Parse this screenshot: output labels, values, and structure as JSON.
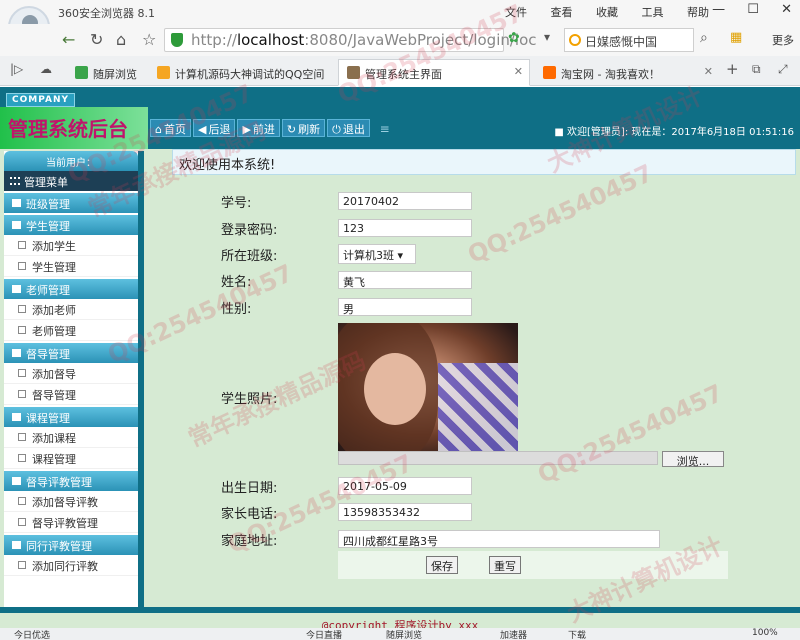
{
  "browser": {
    "title": "360安全浏览器 8.1",
    "menu": [
      "文件",
      "查看",
      "收藏",
      "工具",
      "帮助"
    ],
    "url_prefix": "http://",
    "url_host": "localhost",
    "url_rest": ":8080/JavaWebProject/login/loc",
    "search_text": "日媒感慨中国",
    "more_label": "更多",
    "tabs": [
      {
        "label": "随屏浏览",
        "color": "#3aa44a"
      },
      {
        "label": "计算机源码大神调试的QQ空间",
        "color": "#f5a623"
      },
      {
        "label": "管理系统主界面",
        "color": "#8a6f4e"
      },
      {
        "label": "淘宝网 - 淘我喜欢！",
        "color": "#ff6a00"
      }
    ]
  },
  "app": {
    "company": "COMPANY",
    "system_title": "管理系统后台",
    "toolbar": [
      "首页",
      "后退",
      "前进",
      "刷新",
      "退出"
    ],
    "welcome_top": "欢迎[管理员]:  现在是：2017年6月18日 01:51:16",
    "sidebar": {
      "current_user": "当前用户：",
      "menu_title": "管理菜单",
      "groups": [
        {
          "title": "班级管理",
          "items": []
        },
        {
          "title": "学生管理",
          "items": [
            "添加学生",
            "学生管理"
          ]
        },
        {
          "title": "老师管理",
          "items": [
            "添加老师",
            "老师管理"
          ]
        },
        {
          "title": "督导管理",
          "items": [
            "添加督导",
            "督导管理"
          ]
        },
        {
          "title": "课程管理",
          "items": [
            "添加课程",
            "课程管理"
          ]
        },
        {
          "title": "督导评教管理",
          "items": [
            "添加督导评教",
            "督导评教管理"
          ]
        },
        {
          "title": "同行评教管理",
          "items": [
            "添加同行评教"
          ]
        }
      ]
    },
    "welcome": "欢迎使用本系统!",
    "form": {
      "student_no": {
        "label": "学号:",
        "value": "20170402"
      },
      "password": {
        "label": "登录密码:",
        "value": "123"
      },
      "class": {
        "label": "所在班级:",
        "value": "计算机3班"
      },
      "name": {
        "label": "姓名:",
        "value": "黄飞"
      },
      "gender": {
        "label": "性别:",
        "value": "男"
      },
      "photo": {
        "label": "学生照片:"
      },
      "browse_label": "浏览...",
      "birth": {
        "label": "出生日期:",
        "value": "2017-05-09"
      },
      "phone": {
        "label": "家长电话:",
        "value": "13598353432"
      },
      "address": {
        "label": "家庭地址:",
        "value": "四川成都红星路3号"
      },
      "save_label": "保存",
      "reset_label": "重写"
    },
    "footer": "@copyright  程序设计by xxx"
  },
  "statusbar": [
    "今日优选",
    "今日直播",
    "随屏浏览",
    "加速器",
    "下载",
    "100%"
  ],
  "watermarks": [
    "QQ:254540457",
    "大神计算机设计",
    "常年承接精品源码"
  ]
}
